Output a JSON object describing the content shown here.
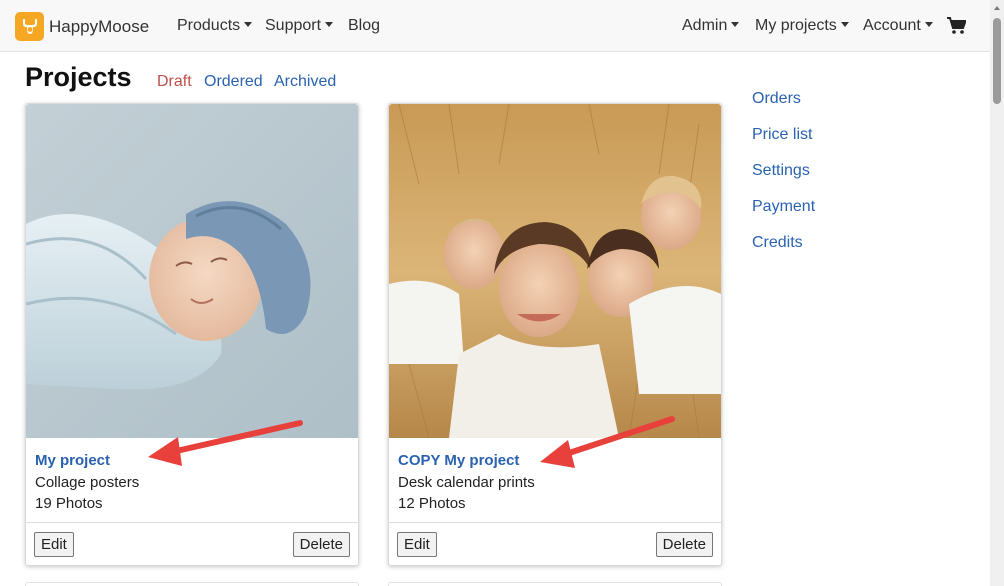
{
  "navbar": {
    "brand": "HappyMoose",
    "left_items": [
      {
        "label": "Products",
        "dropdown": true
      },
      {
        "label": "Support",
        "dropdown": true
      },
      {
        "label": "Blog",
        "dropdown": false
      }
    ],
    "right_items": [
      {
        "label": "Admin",
        "dropdown": true
      },
      {
        "label": "My projects",
        "dropdown": true
      },
      {
        "label": "Account",
        "dropdown": true
      }
    ],
    "cart_icon": "shopping-cart-icon"
  },
  "page": {
    "title": "Projects",
    "filters": [
      {
        "label": "Draft",
        "color": "#c0504d"
      },
      {
        "label": "Ordered",
        "color": "#2a62b0"
      },
      {
        "label": "Archived",
        "color": "#2a62b0"
      }
    ]
  },
  "sidebar": {
    "links": [
      "Orders",
      "Price list",
      "Settings",
      "Payment",
      "Credits"
    ]
  },
  "projects": [
    {
      "title": "My project",
      "product": "Collage posters",
      "photos": "19 Photos",
      "edit_label": "Edit",
      "delete_label": "Delete"
    },
    {
      "title": "COPY My project",
      "product": "Desk calendar prints",
      "photos": "12 Photos",
      "edit_label": "Edit",
      "delete_label": "Delete"
    }
  ],
  "colors": {
    "link": "#2a62b0",
    "accent": "#f5a623",
    "annotation_arrow": "#e8413c"
  }
}
